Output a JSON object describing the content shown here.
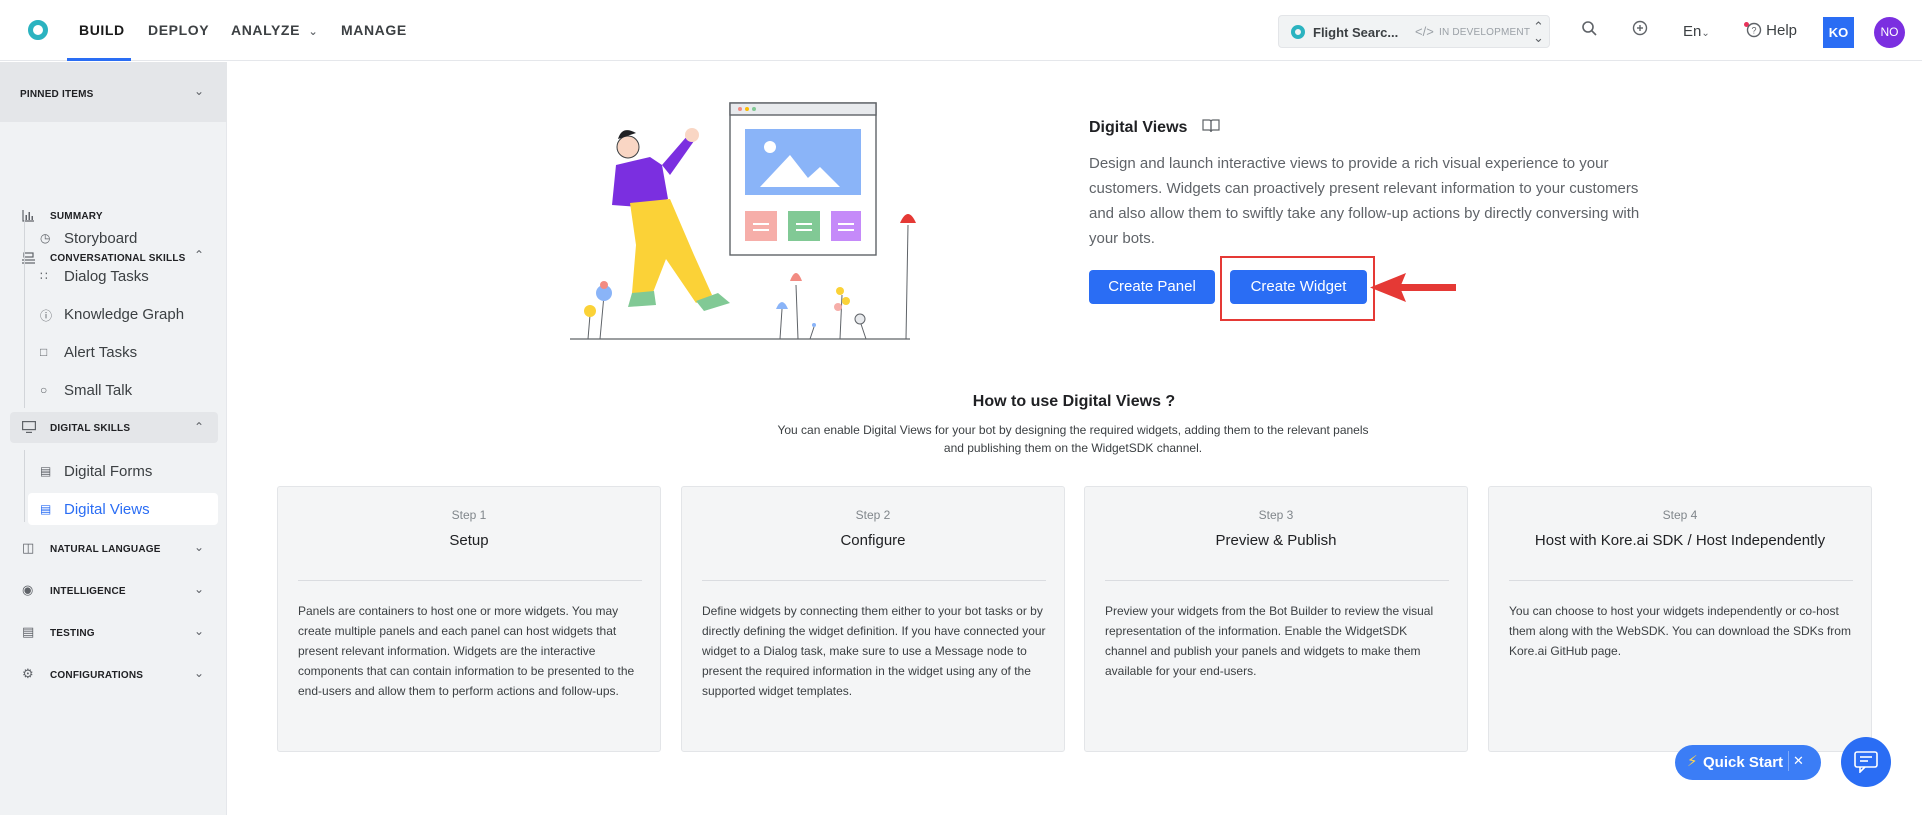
{
  "nav": {
    "build": "BUILD",
    "deploy": "DEPLOY",
    "analyze": "ANALYZE",
    "manage": "MANAGE",
    "bot_name": "Flight Searc...",
    "bot_status": "IN DEVELOPMENT",
    "language": "En",
    "help": "Help",
    "avatar_initials": "KO",
    "profile_initials": "NO"
  },
  "sidebar": {
    "pinned": "PINNED ITEMS",
    "summary": "SUMMARY",
    "conversational": "CONVERSATIONAL SKILLS",
    "conv_items": [
      "Storyboard",
      "Dialog Tasks",
      "Knowledge Graph",
      "Alert Tasks",
      "Small Talk"
    ],
    "digital": "DIGITAL SKILLS",
    "digital_items": [
      "Digital Forms",
      "Digital Views"
    ],
    "natural_language": "NATURAL LANGUAGE",
    "intelligence": "INTELLIGENCE",
    "testing": "TESTING",
    "configurations": "CONFIGURATIONS"
  },
  "hero": {
    "title": "Digital Views",
    "description": "Design and launch interactive views to provide a rich visual experience to your customers. Widgets can proactively present relevant information to your customers and also allow them to swiftly take any follow-up actions by directly conversing with your bots.",
    "create_panel": "Create Panel",
    "create_widget": "Create Widget"
  },
  "how_to": {
    "title": "How to use Digital Views ?",
    "subtitle": "You can enable Digital Views for your bot by designing the required widgets, adding them to the relevant panels and publishing them on the WidgetSDK channel.",
    "steps": [
      {
        "num": "Step 1",
        "title": "Setup",
        "body": "Panels are containers to host one or more widgets. You may create multiple panels and each panel can host widgets that present relevant information. Widgets are the interactive components that can contain information to be presented to the end-users and allow them to perform actions and follow-ups."
      },
      {
        "num": "Step 2",
        "title": "Configure",
        "body": "Define widgets by connecting them either to your bot tasks or by directly defining the widget definition. If you have connected your widget to a Dialog task, make sure to use a Message node to present the required information in the widget using any of the supported widget templates."
      },
      {
        "num": "Step 3",
        "title": "Preview & Publish",
        "body": "Preview your widgets from the Bot Builder to review the visual representation of the information. Enable the WidgetSDK channel and publish your panels and widgets to make them available for your end-users."
      },
      {
        "num": "Step 4",
        "title": "Host with Kore.ai SDK / Host Independently",
        "body": "You can choose to host your widgets independently or co-host them along with the WebSDK. You can download the SDKs from Kore.ai GitHub page."
      }
    ]
  },
  "quick_start": {
    "label": "Quick Start"
  },
  "colors": {
    "accent": "#2a6df4",
    "highlight": "#e53935",
    "brand": "#2bb3c0"
  },
  "icons": [
    "search-icon",
    "add-circle-icon",
    "help-icon",
    "book-icon",
    "chat-icon",
    "bolt-icon",
    "close-icon"
  ]
}
